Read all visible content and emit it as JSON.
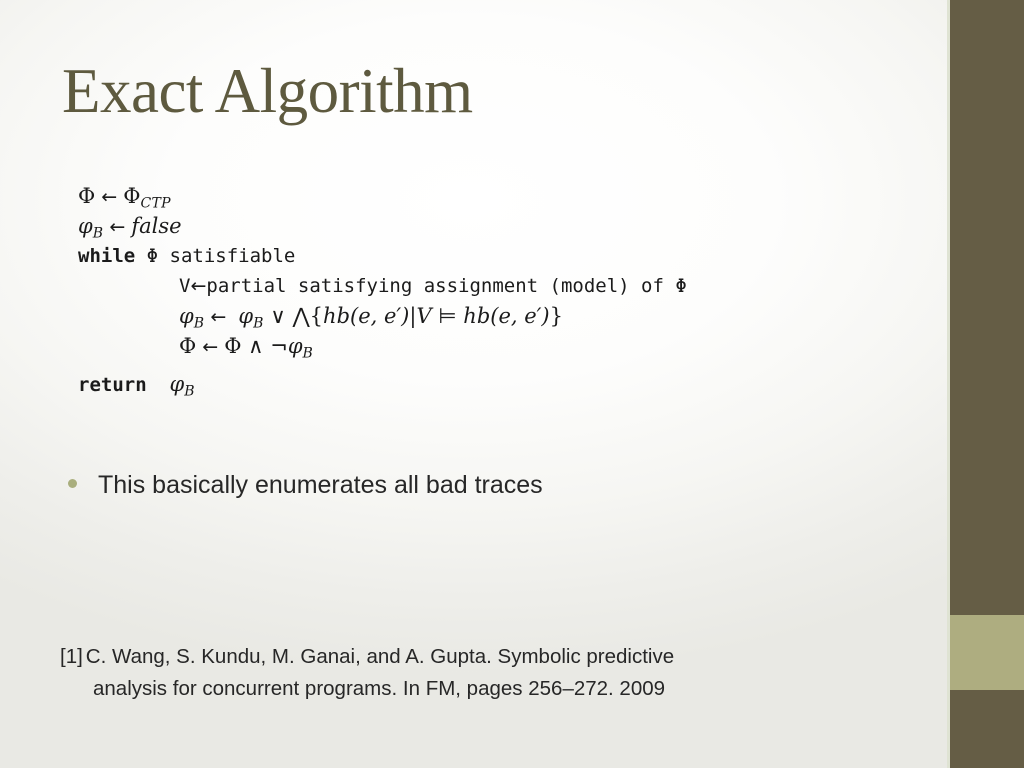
{
  "slide": {
    "title": "Exact Algorithm",
    "accent_dark": "#655D45",
    "accent_light": "#AEAD80",
    "title_color": "#5E5A3F",
    "bullet_color": "#A9AE7D"
  },
  "algorithm": {
    "lines": [
      {
        "id": "init-phi",
        "text": "Φ ← Φ_CTP",
        "parts": {
          "lhs": "Φ",
          "arrow": "←",
          "rhs": "Φ",
          "rhs_sub": "CTP"
        }
      },
      {
        "id": "init-phi-b",
        "text": "φ_B ← false",
        "parts": {
          "lhs": "φ",
          "lhs_sub": "B",
          "arrow": "←",
          "rhs": "false"
        }
      },
      {
        "id": "while-loop",
        "text": "while Φ satisfiable",
        "parts": {
          "keyword": "while",
          "condition": " Φ satisfiable"
        }
      },
      {
        "id": "assign-v",
        "text": "V ← partial satisfying assignment (model) of Φ",
        "parts": {
          "lhs": "V",
          "arrow": "←",
          "rhs": "partial satisfying assignment (model) of Φ"
        }
      },
      {
        "id": "update-phi-b",
        "text": "φ_B ← φ_B ∨ ∧{hb(e, e′)|V ⊨ hb(e, e′)}",
        "parts": {
          "lhs": "φ",
          "lhs_sub": "B",
          "arrow": "←",
          "rhs_1": "φ",
          "rhs_1_sub": "B",
          "or": "∨",
          "and": "⋀",
          "set_open": "{",
          "hb_1": "hb(e, e′)",
          "bar": "|",
          "v": "V",
          "models": "⊨",
          "hb_2": "hb(e, e′)",
          "set_close": "}"
        }
      },
      {
        "id": "update-phi",
        "text": "Φ ← Φ ∧ ¬φ_B",
        "parts": {
          "lhs": "Φ",
          "arrow": "←",
          "rhs": "Φ",
          "and": "∧",
          "not": "¬",
          "phi_b": "φ",
          "phi_b_sub": "B"
        }
      },
      {
        "id": "return",
        "text": "return φ_B",
        "parts": {
          "keyword": "return",
          "value": "φ",
          "value_sub": "B"
        }
      }
    ]
  },
  "bullets": [
    {
      "text": "This basically enumerates all bad traces"
    }
  ],
  "citation": {
    "tag": "[1]",
    "line1": "C. Wang, S. Kundu, M. Ganai, and A. Gupta. Symbolic predictive",
    "line2": "analysis for concurrent programs. In FM, pages 256–272. 2009"
  }
}
